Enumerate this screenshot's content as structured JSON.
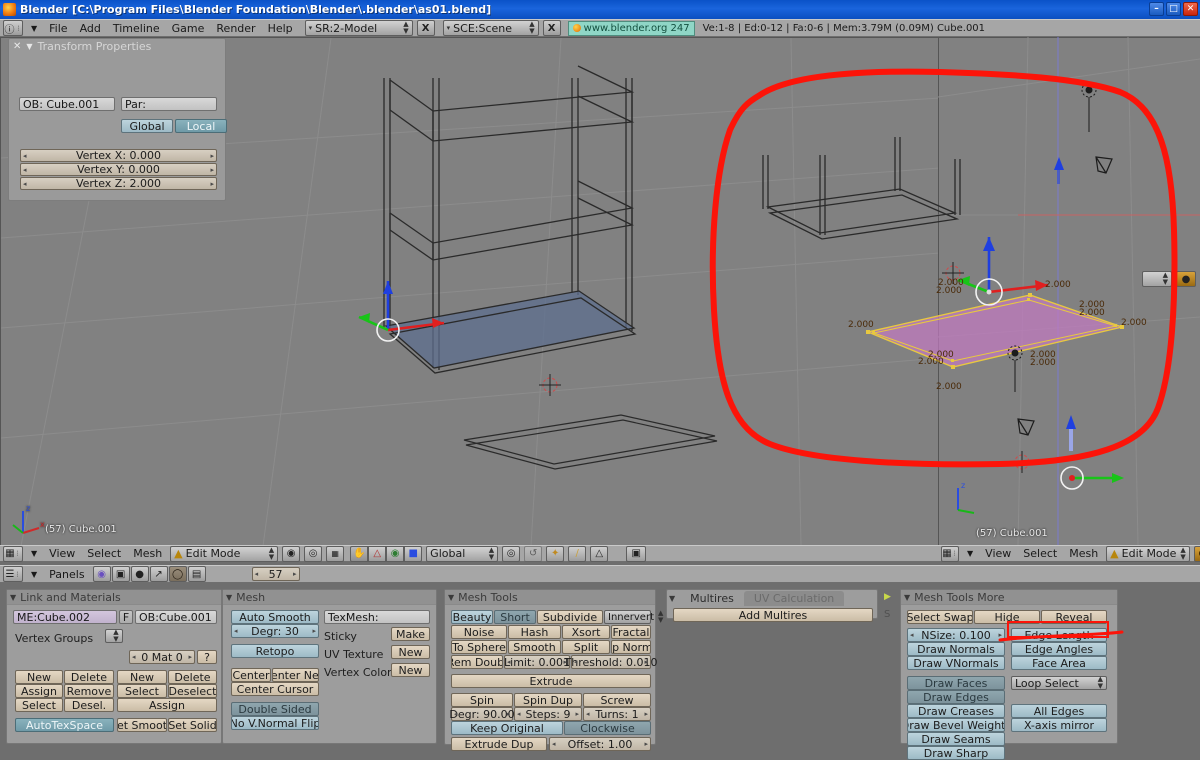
{
  "window": {
    "title": "Blender [C:\\Program Files\\Blender Foundation\\Blender\\.blender\\as01.blend]",
    "app_icon": "blender-logo-icon",
    "minimize": "–",
    "maximize": "□",
    "close": "✕"
  },
  "top_header": {
    "window_type_icon": "info-window-icon",
    "menu_collapse_icon": "chevron-down-icon",
    "menus": [
      "File",
      "Add",
      "Timeline",
      "Game",
      "Render",
      "Help"
    ],
    "screen_selector": {
      "value": "SR:2-Model",
      "delete_label": "X"
    },
    "scene_selector": {
      "value": "SCE:Scene",
      "delete_label": "X"
    },
    "version_badge": "www.blender.org 247",
    "stats": "Ve:1-8 | Ed:0-12 | Fa:0-6 | Mem:3.79M (0.09M) Cube.001"
  },
  "transform_panel": {
    "title": "Transform Properties",
    "close_icon": "close-icon",
    "collapse_icon": "triangle-down-icon",
    "object_name": "OB: Cube.001",
    "parent_label": "Par:",
    "global_label": "Global",
    "local_label": "Local",
    "rows": [
      {
        "label": "Vertex X: 0.000"
      },
      {
        "label": "Vertex Y: 0.000"
      },
      {
        "label": "Vertex Z: 2.000"
      }
    ]
  },
  "viewport_left": {
    "status": "(57) Cube.001",
    "axis_x": "x",
    "axis_y": "y",
    "axis_z": "z",
    "header": {
      "window_type_icon": "3d-view-icon",
      "menu_collapse_icon": "chevron-down-icon",
      "menus": [
        "View",
        "Select",
        "Mesh"
      ],
      "mode": "Edit Mode",
      "mode_icon": "edit-mode-icon",
      "draw_type_icon": "solid-shading-icon",
      "pivot_icon": "pivot-median-icon",
      "snap_icon": "snap-grid-icon",
      "vertex_select_icon": "vertex-select-icon",
      "edge_select_icon": "edge-select-icon",
      "face_select_icon": "face-select-icon",
      "occlude_icon": "occlude-geometry-icon",
      "transform_orientation": "Global",
      "manipulator_icon": "manipulator-icon",
      "rotate_manip_icon": "rotate-manipulator-icon",
      "layer_icons": [
        "proportional-edit-icon",
        "falloff-icon",
        "render-icon"
      ],
      "render_window_icon": "render-window-icon"
    }
  },
  "viewport_right": {
    "status": "(57) Cube.001",
    "axis_x": "x",
    "axis_y": "y",
    "axis_z": "z",
    "header": {
      "window_type_icon": "3d-view-icon",
      "menu_collapse_icon": "chevron-down-icon",
      "menus": [
        "View",
        "Select",
        "Mesh"
      ],
      "mode": "Edit Mode",
      "mode_icon": "edit-mode-icon",
      "draw_type_icon": "textured-shading-icon"
    },
    "edge_lengths": [
      "2.000",
      "2.000",
      "2.000",
      "2.000",
      "2.000",
      "2.000",
      "2.000",
      "2.000",
      "2.000",
      "2.000",
      "2.000",
      "2.000"
    ],
    "objects": {
      "lamp_icon": "lamp-object-icon",
      "camera_icon": "camera-object-icon",
      "cursor_icon": "3d-cursor-icon"
    }
  },
  "annotation": {
    "color": "#fc1409",
    "circle_label": "red-circle-annotation",
    "underline_label": "red-underline-annotation",
    "highlight_label": "red-highlight-box"
  },
  "buttons_header": {
    "window_type_icon": "buttons-window-icon",
    "menu_collapse_icon": "chevron-down-icon",
    "menu": "Panels",
    "context_icons": [
      "shading-context-icon",
      "object-context-icon",
      "physics-context-icon",
      "editing-context-icon",
      "scene-context-icon",
      "logic-context-icon"
    ],
    "active_context_index": 4,
    "frame_field": "57"
  },
  "panels": {
    "link_and_materials": {
      "title": "Link and Materials",
      "mesh_field": "ME:Cube.002",
      "f_label": "F",
      "ob_field": "OB:Cube.001",
      "vertex_groups_label": "Vertex Groups",
      "material_index": "0 Mat 0",
      "help_label": "?",
      "vg_buttons": [
        "New",
        "Delete",
        "Assign",
        "Remove",
        "Select",
        "Desel."
      ],
      "mat_buttons": [
        "New",
        "Delete",
        "Select",
        "Deselect"
      ],
      "assign_label": "Assign",
      "autotexspace": "AutoTexSpace",
      "set_smooth": "Set Smooth",
      "set_solid": "Set Solid"
    },
    "mesh": {
      "title": "Mesh",
      "auto_smooth": "Auto Smooth",
      "degr": "Degr: 30",
      "retopo": "Retopo",
      "center": "Center",
      "center_new": "Center New",
      "center_cursor": "Center Cursor",
      "double_sided": "Double Sided",
      "no_vnormal_flip": "No V.Normal Flip",
      "texmesh": "TexMesh:",
      "sticky_label": "Sticky",
      "sticky_btn": "Make",
      "uv_texture_label": "UV Texture",
      "uv_texture_btn": "New",
      "vertex_color_label": "Vertex Color",
      "vertex_color_btn": "New"
    },
    "mesh_tools": {
      "title": "Mesh Tools",
      "beauty": "Beauty",
      "short": "Short",
      "subdivide": "Subdivide",
      "innervert": "Innervert",
      "row2": [
        "Noise",
        "Hash",
        "Xsort",
        "Fractal"
      ],
      "row3": [
        "To Sphere",
        "Smooth",
        "Split",
        "Flip Normal"
      ],
      "rem_doubl": "Rem Doubl",
      "limit": "Limit: 0.001",
      "threshold": "Threshold: 0.010",
      "extrude": "Extrude",
      "spin": "Spin",
      "spin_dup": "Spin Dup",
      "screw": "Screw",
      "degr": "Degr: 90.00",
      "steps": "Steps: 9",
      "turns": "Turns: 1",
      "keep_original": "Keep Original",
      "clockwise": "Clockwise",
      "extrude_dup": "Extrude Dup",
      "offset": "Offset: 1.00"
    },
    "multires": {
      "tab_active": "Multires",
      "tab_inactive": "UV Calculation",
      "add_multires": "Add Multires",
      "side_arrow_icon": "panel-expand-arrow-icon",
      "side_letter": "S"
    },
    "mesh_tools_more": {
      "title": "Mesh Tools More",
      "select_swap": "Select Swap",
      "hide": "Hide",
      "reveal": "Reveal",
      "nsize": "NSize: 0.100",
      "draw_normals": "Draw Normals",
      "draw_vnormals": "Draw VNormals",
      "edge_length": "Edge Length",
      "edge_angles": "Edge Angles",
      "face_area": "Face Area",
      "draw_faces": "Draw Faces",
      "draw_edges": "Draw Edges",
      "draw_creases": "Draw Creases",
      "draw_bevel_weights": "Draw Bevel Weights",
      "draw_seams": "Draw Seams",
      "draw_sharp": "Draw Sharp",
      "loop_select": "Loop Select",
      "all_edges": "All Edges",
      "xaxis_mirror": "X-axis mirror"
    }
  }
}
